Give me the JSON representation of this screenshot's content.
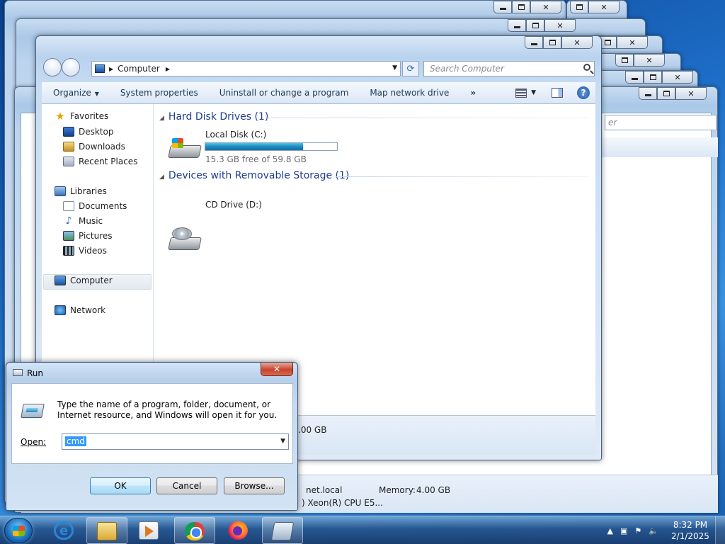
{
  "explorer": {
    "address_segment": "Computer",
    "search_placeholder": "Search Computer",
    "commands": [
      "Organize",
      "System properties",
      "Uninstall or change a program",
      "Map network drive"
    ],
    "more_commands": "»",
    "nav": {
      "favorites": "Favorites",
      "desktop": "Desktop",
      "downloads": "Downloads",
      "recent_places": "Recent Places",
      "libraries": "Libraries",
      "documents": "Documents",
      "music": "Music",
      "pictures": "Pictures",
      "videos": "Videos",
      "computer": "Computer",
      "network": "Network"
    },
    "groups": {
      "hdd_title": "Hard Disk Drives (1)",
      "removable_title": "Devices with Removable Storage (1)"
    },
    "drives": {
      "local_name": "Local Disk (C:)",
      "local_free": "15.3 GB free of 59.8 GB",
      "local_used_fraction": 0.744,
      "cd_name": "CD Drive (D:)"
    }
  },
  "background_window": {
    "search_fragment": "er",
    "memory_fragment": ".00 GB",
    "domain_fragment": "net.local",
    "memory_label": "Memory:",
    "memory_value": "4.00 GB",
    "cpu_fragment": ") Xeon(R) CPU E5..."
  },
  "run_dialog": {
    "title": "Run",
    "description": "Type the name of a program, folder, document, or Internet resource, and Windows will open it for you.",
    "open_label": "Open:",
    "value": "cmd",
    "ok": "OK",
    "cancel": "Cancel",
    "browse": "Browse..."
  },
  "taskbar": {
    "time": "8:32 PM",
    "date": "2/1/2025"
  }
}
